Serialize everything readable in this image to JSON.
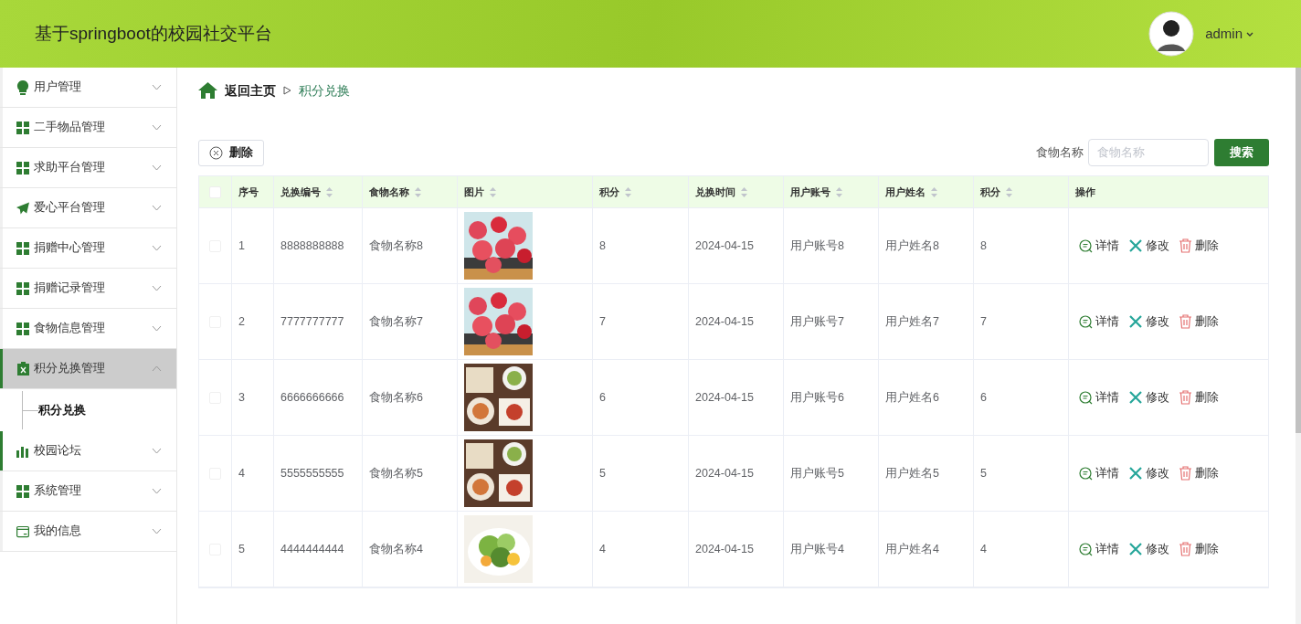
{
  "header": {
    "title": "基于springboot的校园社交平台",
    "user": "admin"
  },
  "sidebar": {
    "items": [
      {
        "label": "用户管理",
        "kind": "bulb",
        "selected": false,
        "expanded": false,
        "highlighted": false
      },
      {
        "label": "二手物品管理",
        "kind": "grid",
        "selected": false,
        "expanded": false,
        "highlighted": false
      },
      {
        "label": "求助平台管理",
        "kind": "grid",
        "selected": false,
        "expanded": false,
        "highlighted": false
      },
      {
        "label": "爱心平台管理",
        "kind": "plane",
        "selected": false,
        "expanded": false,
        "highlighted": false
      },
      {
        "label": "捐赠中心管理",
        "kind": "grid",
        "selected": false,
        "expanded": false,
        "highlighted": false
      },
      {
        "label": "捐赠记录管理",
        "kind": "grid",
        "selected": false,
        "expanded": false,
        "highlighted": false
      },
      {
        "label": "食物信息管理",
        "kind": "grid",
        "selected": false,
        "expanded": false,
        "highlighted": false
      },
      {
        "label": "积分兑换管理",
        "kind": "clipboard",
        "selected": true,
        "expanded": true,
        "highlighted": true,
        "children": [
          {
            "label": "积分兑换"
          }
        ]
      },
      {
        "label": "校园论坛",
        "kind": "chart",
        "selected": false,
        "expanded": false,
        "highlighted": true
      },
      {
        "label": "系统管理",
        "kind": "grid",
        "selected": false,
        "expanded": false,
        "highlighted": false
      },
      {
        "label": "我的信息",
        "kind": "card",
        "selected": false,
        "expanded": false,
        "highlighted": false
      }
    ]
  },
  "breadcrumb": {
    "home": "返回主页",
    "current": "积分兑换"
  },
  "toolbar": {
    "delete": "删除",
    "search_label": "食物名称",
    "search_placeholder": "食物名称",
    "search_button": "搜索"
  },
  "table": {
    "all_checked": false,
    "columns": [
      {
        "label": "序号",
        "sortable": false
      },
      {
        "label": "兑换编号",
        "sortable": true
      },
      {
        "label": "食物名称",
        "sortable": true
      },
      {
        "label": "图片",
        "sortable": true
      },
      {
        "label": "积分",
        "sortable": true
      },
      {
        "label": "兑换时间",
        "sortable": true
      },
      {
        "label": "用户账号",
        "sortable": true
      },
      {
        "label": "用户姓名",
        "sortable": true
      },
      {
        "label": "积分",
        "sortable": true
      },
      {
        "label": "操作",
        "sortable": false
      }
    ],
    "rows": [
      {
        "checked": false,
        "cells": [
          "1",
          "8888888888",
          "食物名称8",
          "",
          "8",
          "2024-04-15",
          "用户账号8",
          "用户姓名8",
          "8"
        ],
        "actions": [
          "详情",
          "修改",
          "删除"
        ]
      },
      {
        "checked": false,
        "cells": [
          "2",
          "7777777777",
          "食物名称7",
          "",
          "7",
          "2024-04-15",
          "用户账号7",
          "用户姓名7",
          "7"
        ],
        "actions": [
          "详情",
          "修改",
          "删除"
        ]
      },
      {
        "checked": false,
        "cells": [
          "3",
          "6666666666",
          "食物名称6",
          "",
          "6",
          "2024-04-15",
          "用户账号6",
          "用户姓名6",
          "6"
        ],
        "actions": [
          "详情",
          "修改",
          "删除"
        ]
      },
      {
        "checked": false,
        "cells": [
          "4",
          "5555555555",
          "食物名称5",
          "",
          "5",
          "2024-04-15",
          "用户账号5",
          "用户姓名5",
          "5"
        ],
        "actions": [
          "详情",
          "修改",
          "删除"
        ]
      },
      {
        "checked": false,
        "cells": [
          "5",
          "4444444444",
          "食物名称4",
          "",
          "4",
          "2024-04-15",
          "用户账号4",
          "用户姓名4",
          "4"
        ],
        "actions": [
          "详情",
          "修改",
          "删除"
        ]
      }
    ]
  }
}
